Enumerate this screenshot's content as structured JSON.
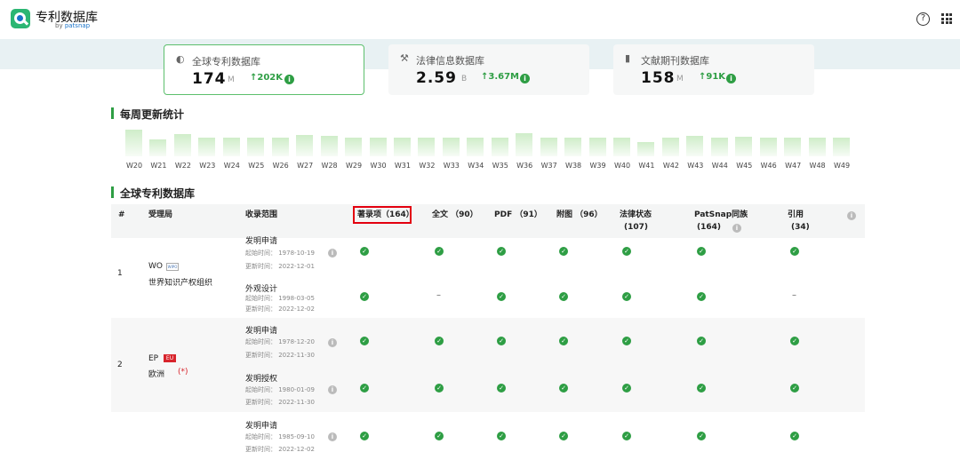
{
  "header": {
    "app_title": "专利数据库",
    "app_sub_prefix": "by",
    "app_sub_brand": "patsnap",
    "help_icon": "question-circle-icon",
    "apps_icon": "grid-icon"
  },
  "cards": [
    {
      "icon": "planet-icon",
      "label": "全球专利数据库",
      "value": "174",
      "unit": "M",
      "delta": "↑202K"
    },
    {
      "icon": "gavel-icon",
      "label": "法律信息数据库",
      "value": "2.59",
      "unit": "B",
      "delta": "↑3.67M"
    },
    {
      "icon": "book-icon",
      "label": "文献期刊数据库",
      "value": "158",
      "unit": "M",
      "delta": "↑91K"
    }
  ],
  "weekly": {
    "title": "每周更新统计",
    "weeks": [
      "W20",
      "W21",
      "W22",
      "W23",
      "W24",
      "W25",
      "W26",
      "W27",
      "W28",
      "W29",
      "W30",
      "W31",
      "W32",
      "W33",
      "W34",
      "W35",
      "W36",
      "W37",
      "W38",
      "W39",
      "W40",
      "W41",
      "W42",
      "W43",
      "W44",
      "W45",
      "W46",
      "W47",
      "W48",
      "W49"
    ],
    "levels": [
      1.0,
      0.63,
      0.83,
      0.7,
      0.7,
      0.7,
      0.7,
      0.8,
      0.77,
      0.7,
      0.7,
      0.7,
      0.7,
      0.7,
      0.7,
      0.7,
      0.86,
      0.7,
      0.7,
      0.7,
      0.7,
      0.53,
      0.7,
      0.77,
      0.7,
      0.73,
      0.7,
      0.7,
      0.7,
      0.7
    ]
  },
  "db": {
    "title": "全球专利数据库",
    "columns": {
      "idx": "#",
      "office": "受理局",
      "scope": "收录范围",
      "biblio": "著录项（164）",
      "fulltext": "全文 （90）",
      "pdf": "PDF （91）",
      "figure": "附图 （96）",
      "legal": "法律状态",
      "legal_count": "(107)",
      "family": "PatSnap同族",
      "family_count": "(164)",
      "cite": "引用",
      "cite_count": "(34)"
    },
    "rows": [
      {
        "idx": "1",
        "code": "WO",
        "flag": "WIPO",
        "name": "世界知识产权组织",
        "entries": [
          {
            "type": "发明申请",
            "start": "起始时间： 1978-10-19",
            "update": "更新时间： 2022-12-01"
          },
          {
            "type": "外观设计",
            "start": "起始时间： 1998-03-05",
            "update": "更新时间： 2022-12-02"
          }
        ]
      },
      {
        "idx": "2",
        "code": "EP",
        "flag": "EU",
        "name": "欧洲",
        "note": "(*)",
        "entries": [
          {
            "type": "发明申请",
            "start": "起始时间： 1978-12-20",
            "update": "更新时间： 2022-11-30"
          },
          {
            "type": "发明授权",
            "start": "起始时间： 1980-01-09",
            "update": "更新时间： 2022-11-30"
          }
        ]
      },
      {
        "idx": "",
        "code": "",
        "name": "",
        "entries": [
          {
            "type": "发明申请",
            "start": "起始时间： 1985-09-10",
            "update": "更新时间： 2022-12-02"
          }
        ]
      }
    ],
    "dash": "–"
  },
  "colors": {
    "accent": "#2e9e44",
    "highlight": "#e3000f",
    "band": "#e8f1f3"
  }
}
